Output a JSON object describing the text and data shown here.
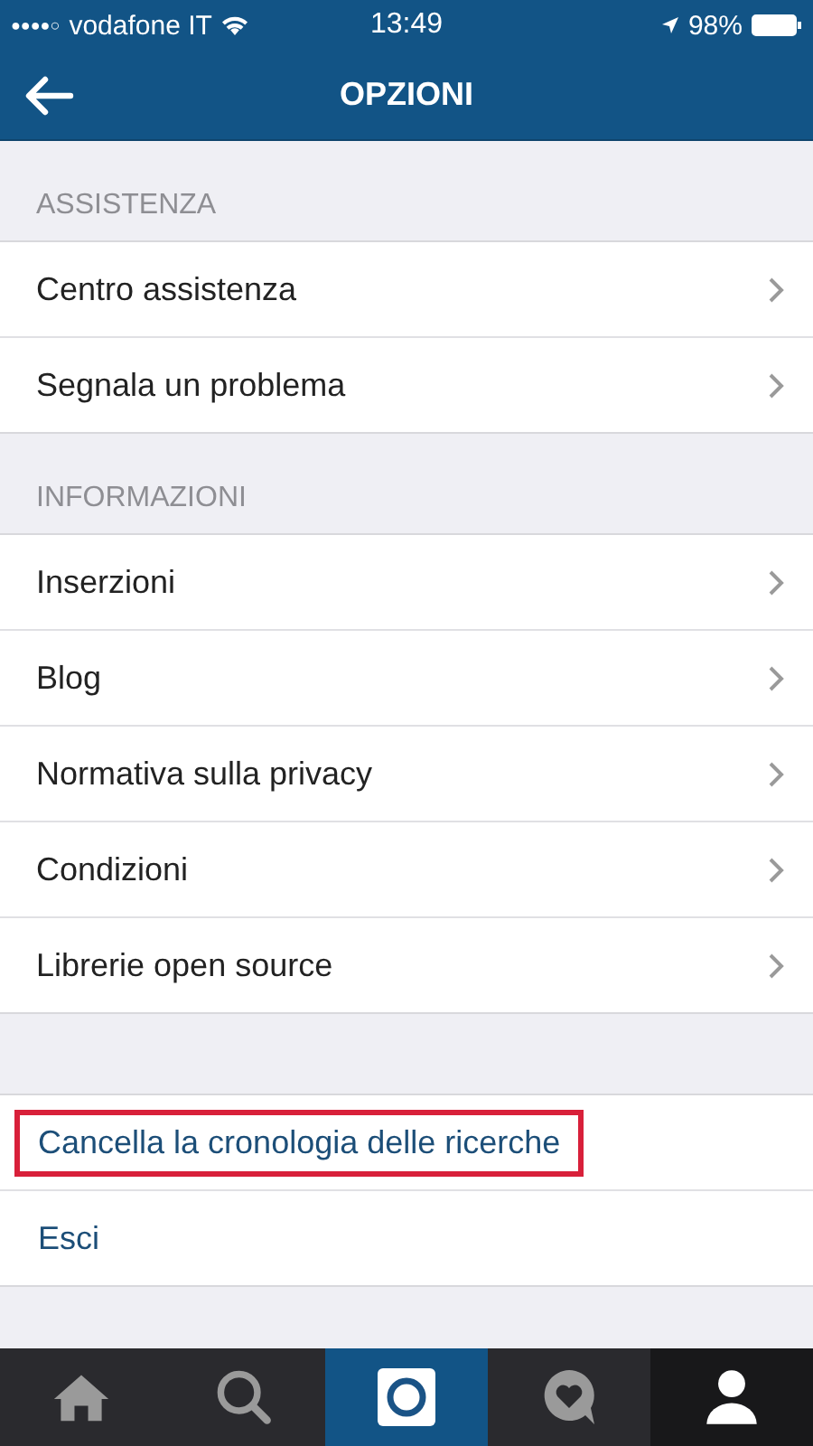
{
  "status_bar": {
    "signal_dots": "●●●●○",
    "carrier": "vodafone IT",
    "time": "13:49",
    "battery": "98%"
  },
  "header": {
    "title": "OPZIONI"
  },
  "sections": [
    {
      "title": "ASSISTENZA",
      "items": [
        "Centro assistenza",
        "Segnala un problema"
      ]
    },
    {
      "title": "INFORMAZIONI",
      "items": [
        "Inserzioni",
        "Blog",
        "Normativa sulla privacy",
        "Condizioni",
        "Librerie open source"
      ]
    }
  ],
  "actions": [
    {
      "label": "Cancella la cronologia delle ricerche",
      "highlighted": true
    },
    {
      "label": "Esci",
      "highlighted": false
    }
  ],
  "tab_bar": [
    {
      "kind": "home",
      "selected": false
    },
    {
      "kind": "search",
      "selected": false
    },
    {
      "kind": "camera",
      "selected": false
    },
    {
      "kind": "activity",
      "selected": false
    },
    {
      "kind": "profile",
      "selected": true
    }
  ]
}
